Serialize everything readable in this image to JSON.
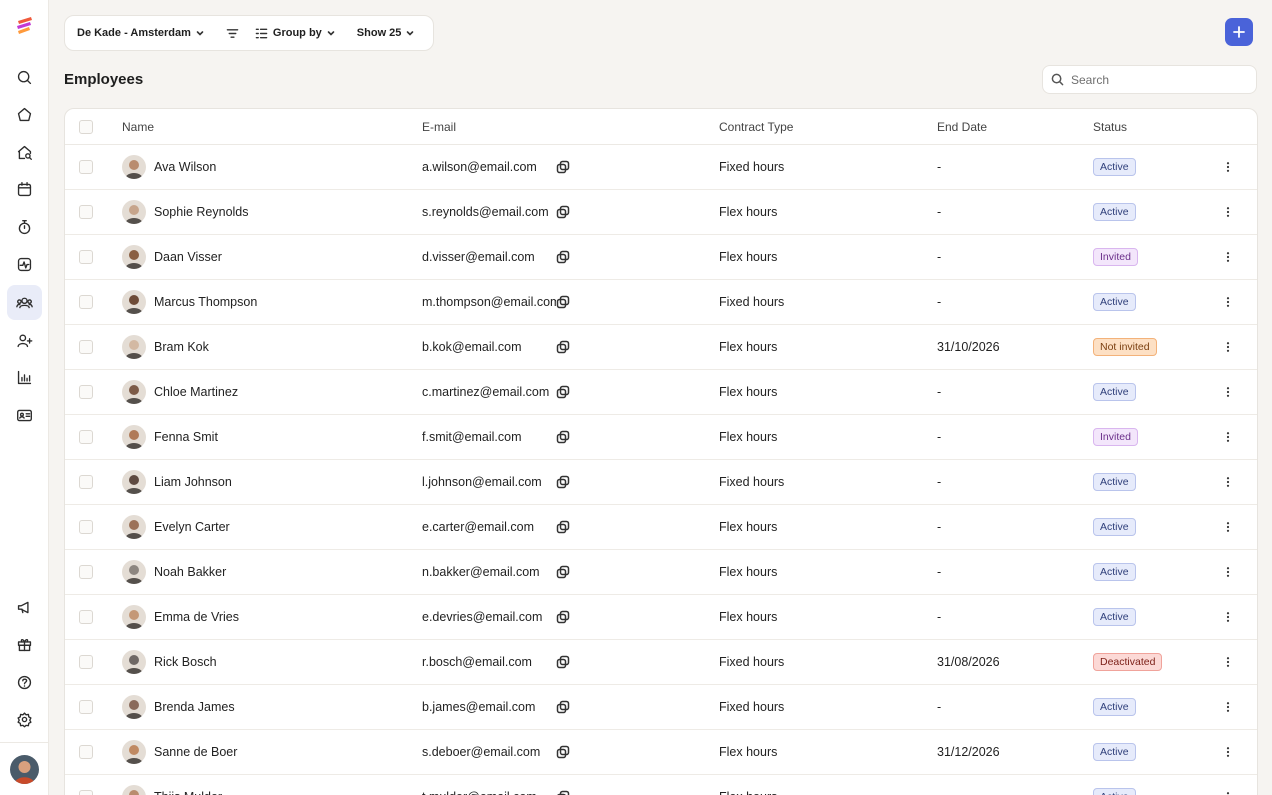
{
  "toolbar": {
    "location": "De Kade - Amsterdam",
    "group_by": "Group by",
    "show": "Show 25"
  },
  "page": {
    "title": "Employees"
  },
  "search": {
    "placeholder": "Search"
  },
  "columns": {
    "name": "Name",
    "email": "E-mail",
    "contract": "Contract Type",
    "end_date": "End Date",
    "status": "Status"
  },
  "status_colors": {
    "Active": {
      "bg": "#e6ebfb",
      "border": "#b9c4ec",
      "text": "#2f3f7a"
    },
    "Invited": {
      "bg": "#f3e6fb",
      "border": "#d9b6ef",
      "text": "#6b2f8a"
    },
    "Not invited": {
      "bg": "#fde0c4",
      "border": "#f3b27a",
      "text": "#7a3f10"
    },
    "Deactivated": {
      "bg": "#fcd9d6",
      "border": "#f0a39b",
      "text": "#7d221a"
    }
  },
  "avatar_colors": [
    "#b98c6e",
    "#c7a58c",
    "#8a5f42",
    "#6e4b37",
    "#d3b9a3",
    "#7d5b48",
    "#b07a57",
    "#5e4a41",
    "#9c7259",
    "#8d8680",
    "#c49877",
    "#6f6865",
    "#8a6a5a",
    "#c08a63"
  ],
  "employees": [
    {
      "name": "Ava Wilson",
      "email": "a.wilson@email.com",
      "contract": "Fixed hours",
      "end_date": "-",
      "status": "Active"
    },
    {
      "name": "Sophie Reynolds",
      "email": "s.reynolds@email.com",
      "contract": "Flex hours",
      "end_date": "-",
      "status": "Active"
    },
    {
      "name": "Daan Visser",
      "email": "d.visser@email.com",
      "contract": "Flex hours",
      "end_date": "-",
      "status": "Invited"
    },
    {
      "name": "Marcus Thompson",
      "email": "m.thompson@email.com",
      "contract": "Fixed hours",
      "end_date": "-",
      "status": "Active"
    },
    {
      "name": "Bram Kok",
      "email": "b.kok@email.com",
      "contract": "Flex hours",
      "end_date": "31/10/2026",
      "status": "Not invited"
    },
    {
      "name": "Chloe Martinez",
      "email": "c.martinez@email.com",
      "contract": "Flex hours",
      "end_date": "-",
      "status": "Active"
    },
    {
      "name": "Fenna Smit",
      "email": "f.smit@email.com",
      "contract": "Flex hours",
      "end_date": "-",
      "status": "Invited"
    },
    {
      "name": "Liam Johnson",
      "email": "l.johnson@email.com",
      "contract": "Fixed hours",
      "end_date": "-",
      "status": "Active"
    },
    {
      "name": "Evelyn Carter",
      "email": "e.carter@email.com",
      "contract": "Flex hours",
      "end_date": "-",
      "status": "Active"
    },
    {
      "name": "Noah Bakker",
      "email": "n.bakker@email.com",
      "contract": "Flex hours",
      "end_date": "-",
      "status": "Active"
    },
    {
      "name": "Emma de Vries",
      "email": "e.devries@email.com",
      "contract": "Flex hours",
      "end_date": "-",
      "status": "Active"
    },
    {
      "name": "Rick Bosch",
      "email": "r.bosch@email.com",
      "contract": "Fixed hours",
      "end_date": "31/08/2026",
      "status": "Deactivated"
    },
    {
      "name": "Brenda James",
      "email": "b.james@email.com",
      "contract": "Fixed hours",
      "end_date": "-",
      "status": "Active"
    },
    {
      "name": "Sanne de Boer",
      "email": "s.deboer@email.com",
      "contract": "Flex hours",
      "end_date": "31/12/2026",
      "status": "Active"
    },
    {
      "name": "Thijs Mulder",
      "email": "t.mulder@email.com",
      "contract": "Flex hours",
      "end_date": "-",
      "status": "Active"
    }
  ]
}
